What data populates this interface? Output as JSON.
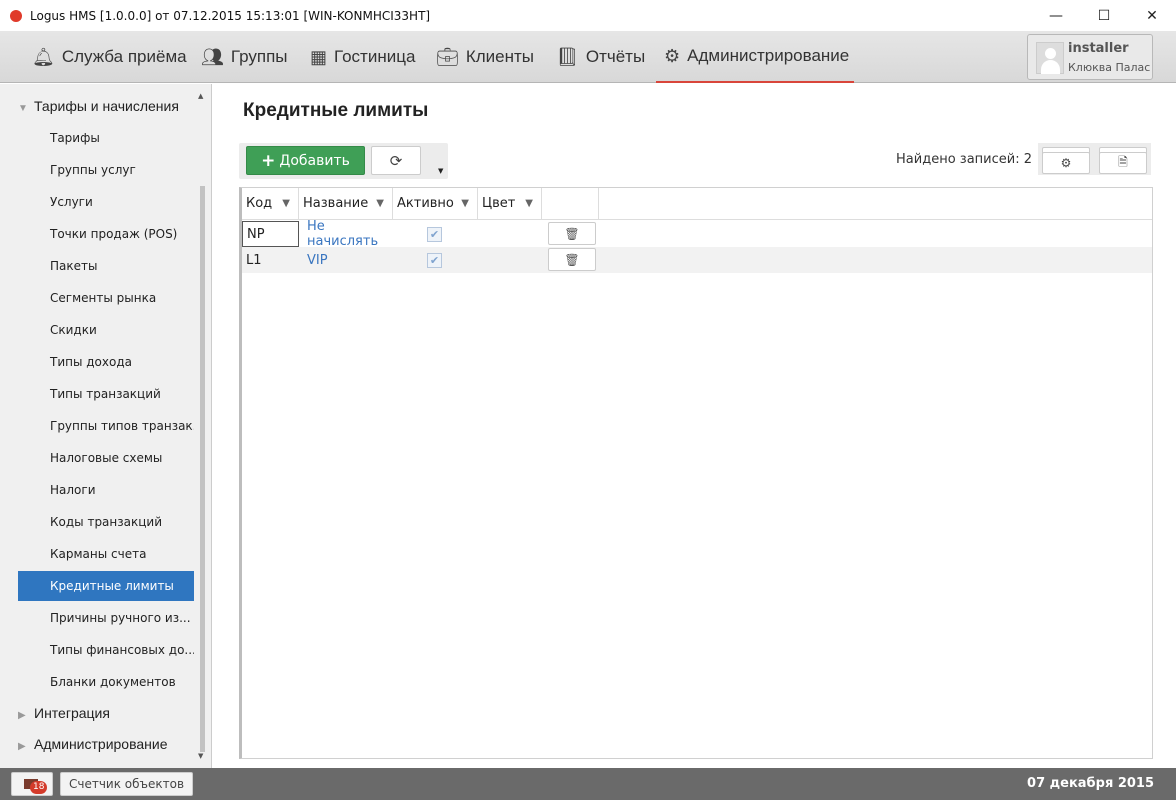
{
  "window": {
    "title": "Logus HMS [1.0.0.0] от 07.12.2015 15:13:01 [WIN-KONMHCI33HT]",
    "minimize": "—",
    "maximize": "☐",
    "close": "✕"
  },
  "nav": [
    {
      "label": "Служба приёма",
      "icon": "bell-icon"
    },
    {
      "label": "Группы",
      "icon": "users-icon"
    },
    {
      "label": "Гостиница",
      "icon": "building-icon"
    },
    {
      "label": "Клиенты",
      "icon": "briefcase-icon"
    },
    {
      "label": "Отчёты",
      "icon": "book-icon"
    },
    {
      "label": "Администрирование",
      "icon": "gears-icon"
    }
  ],
  "user": {
    "name": "installer",
    "hotel": "Клюква Палас"
  },
  "sidebar": {
    "group": "Тарифы и начисления",
    "items": [
      "Тарифы",
      "Группы услуг",
      "Услуги",
      "Точки продаж (POS)",
      "Пакеты",
      "Сегменты рынка",
      "Скидки",
      "Типы дохода",
      "Типы транзакций",
      "Группы типов транзак...",
      "Налоговые схемы",
      "Налоги",
      "Коды транзакций",
      "Карманы счета",
      "Кредитные лимиты",
      "Причины ручного из...",
      "Типы финансовых до...",
      "Бланки документов"
    ],
    "selected": 14,
    "other_groups": [
      "Интеграция",
      "Администрирование"
    ]
  },
  "main": {
    "title": "Кредитные лимиты",
    "add_label": "Добавить",
    "found": "Найдено записей: 2",
    "columns": [
      "Код",
      "Название",
      "Активно",
      "Цвет"
    ],
    "rows": [
      {
        "code": "NP",
        "name": "Не начислять",
        "active": true
      },
      {
        "code": "L1",
        "name": "VIP",
        "active": true
      }
    ]
  },
  "status": {
    "mail_count": "18",
    "counter_label": "Счетчик объектов",
    "date": "07 декабря 2015"
  }
}
